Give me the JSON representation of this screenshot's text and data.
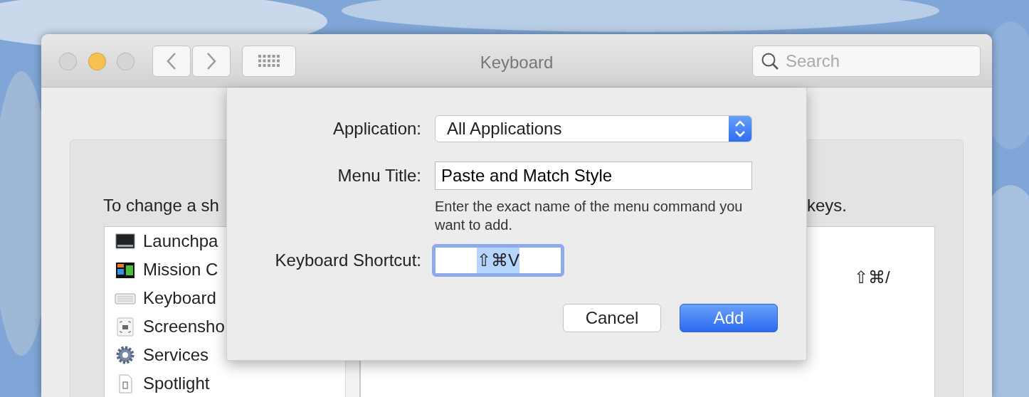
{
  "window": {
    "title": "Keyboard",
    "traffic_lights": [
      {
        "kind": "close",
        "color": "#d6d6d6"
      },
      {
        "kind": "minimize",
        "color": "#f6c14f"
      },
      {
        "kind": "zoom",
        "color": "#d6d6d6"
      }
    ]
  },
  "toolbar": {
    "search": {
      "placeholder": "Search"
    }
  },
  "shortcuts_pane": {
    "instruction_start": "To change a sh",
    "instruction_end": "keys.",
    "categories": [
      {
        "label": "Launchpa",
        "kind": "launchpad"
      },
      {
        "label": "Mission C",
        "kind": "mission"
      },
      {
        "label": "Keyboard",
        "kind": "keyboard"
      },
      {
        "label": "Screensho",
        "kind": "screenshot"
      },
      {
        "label": "Services",
        "kind": "services"
      },
      {
        "label": "Spotlight",
        "kind": "spotlight"
      }
    ],
    "shortcut": "⇧⌘/"
  },
  "sheet": {
    "application": {
      "label": "Application:",
      "value": "All Applications"
    },
    "menu_title": {
      "label": "Menu Title:",
      "value": "Paste and Match Style"
    },
    "help": "Enter the exact name of the menu command you want to add.",
    "keyboard_shortcut": {
      "label": "Keyboard Shortcut:",
      "value": "⇧⌘V",
      "focused": true,
      "selected": true
    },
    "buttons": [
      {
        "label": "Cancel",
        "default": false
      },
      {
        "label": "Add",
        "default": true
      }
    ]
  }
}
